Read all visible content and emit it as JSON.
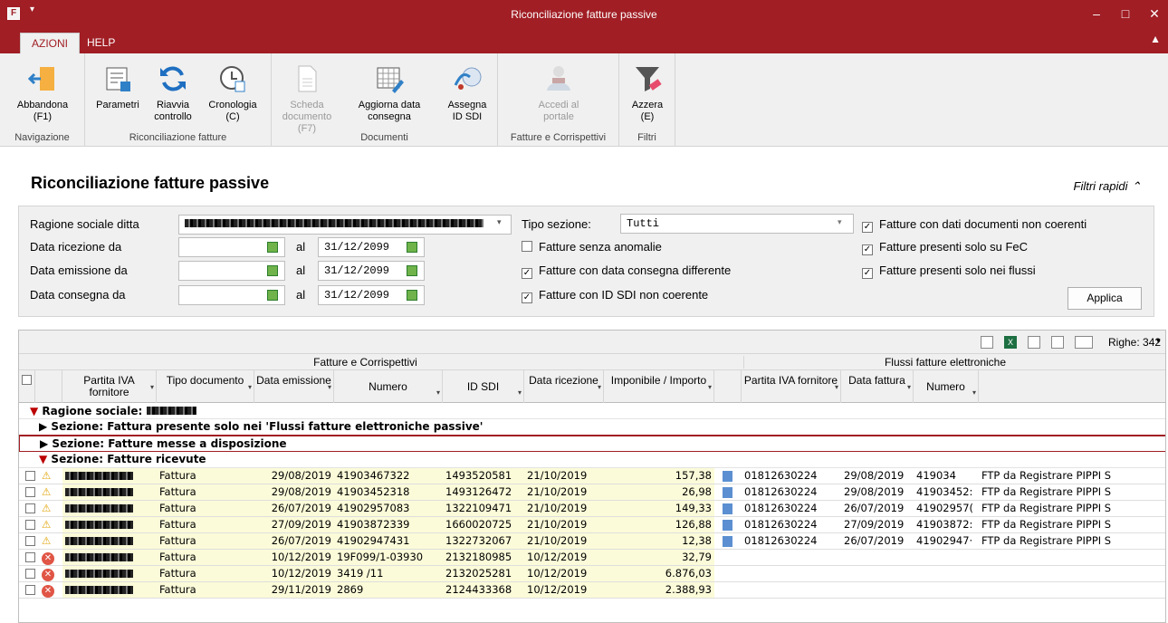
{
  "app": {
    "title": "Riconciliazione fatture passive",
    "icon": "app-logo-icon"
  },
  "tabs": [
    {
      "label": "AZIONI",
      "active": true
    },
    {
      "label": "HELP",
      "active": false
    }
  ],
  "ribbon": {
    "groups": [
      {
        "label": "Navigazione",
        "buttons": [
          {
            "label": "Abbandona",
            "sub": "(F1)",
            "icon": "exit-door-icon",
            "enabled": true
          }
        ]
      },
      {
        "label": "Riconciliazione fatture",
        "buttons": [
          {
            "label": "Parametri",
            "sub": "",
            "icon": "parameters-form-icon",
            "enabled": true
          },
          {
            "label": "Riavvia",
            "sub": "controllo",
            "icon": "refresh-icon",
            "enabled": true
          },
          {
            "label": "Cronologia",
            "sub": "(C)",
            "icon": "history-clock-icon",
            "enabled": true
          }
        ]
      },
      {
        "label": "Documenti",
        "buttons": [
          {
            "label": "Scheda",
            "sub": "documento (F7)",
            "icon": "document-sheet-icon",
            "enabled": false
          },
          {
            "label": "Aggiorna data",
            "sub": "consegna",
            "icon": "calendar-edit-icon",
            "enabled": true
          },
          {
            "label": "Assegna",
            "sub": "ID SDI",
            "icon": "assign-id-icon",
            "enabled": true
          }
        ]
      },
      {
        "label": "Fatture e Corrispettivi",
        "buttons": [
          {
            "label": "Accedi al",
            "sub": "portale",
            "icon": "portal-access-icon",
            "enabled": false
          }
        ]
      },
      {
        "label": "Filtri",
        "buttons": [
          {
            "label": "Azzera",
            "sub": "(E)",
            "icon": "filter-clear-icon",
            "enabled": true
          }
        ]
      }
    ]
  },
  "page": {
    "heading": "Riconciliazione fatture passive",
    "quick_filters": "Filtri rapidi"
  },
  "filters": {
    "ragione_label": "Ragione sociale ditta",
    "ricezione_label": "Data ricezione da",
    "emissione_label": "Data emissione da",
    "consegna_label": "Data consegna da",
    "al": "al",
    "ricezione_to": "31/12/2099",
    "emissione_to": "31/12/2099",
    "consegna_to": "31/12/2099",
    "tipo_label": "Tipo sezione:",
    "tipo_value": "Tutti",
    "checks": [
      {
        "label": "Fatture senza anomalie",
        "checked": false
      },
      {
        "label": "Fatture con data consegna differente",
        "checked": true
      },
      {
        "label": "Fatture con ID SDI non coerente",
        "checked": true
      },
      {
        "label": "Fatture con dati documenti non coerenti",
        "checked": true
      },
      {
        "label": "Fatture presenti solo su FeC",
        "checked": true
      },
      {
        "label": "Fatture presenti solo nei flussi",
        "checked": true
      }
    ],
    "apply_label": "Applica"
  },
  "grid": {
    "righe": "Righe: 342",
    "band1": "Fatture e Corrispettivi",
    "band2": "Flussi fatture elettroniche",
    "columns": [
      "Partita IVA fornitore",
      "Tipo documento",
      "Data emissione",
      "Numero",
      "ID SDI",
      "Data ricezione",
      "Imponibile / Importo",
      "Partita IVA fornitore",
      "Data fattura",
      "Numero"
    ],
    "group_ragione": "Ragione sociale:",
    "sections": [
      "Sezione:  Fattura presente solo nei 'Flussi fatture elettroniche passive'",
      "Sezione:  Fatture messe a disposizione",
      "Sezione:  Fatture ricevute"
    ],
    "rows": [
      {
        "status": "warning",
        "tipo": "Fattura",
        "data_em": "29/08/2019",
        "numero": "41903467322",
        "idsdi": "1493520581",
        "data_ric": "21/10/2019",
        "importo": "157,38",
        "piva2": "01812630224",
        "data_f": "29/08/2019",
        "numero2": "419034",
        "descr": "FTP da Registrare PIPPI S"
      },
      {
        "status": "warning",
        "tipo": "Fattura",
        "data_em": "29/08/2019",
        "numero": "41903452318",
        "idsdi": "1493126472",
        "data_ric": "21/10/2019",
        "importo": "26,98",
        "piva2": "01812630224",
        "data_f": "29/08/2019",
        "numero2": "41903452:",
        "descr": "FTP da Registrare PIPPI S"
      },
      {
        "status": "warning",
        "tipo": "Fattura",
        "data_em": "26/07/2019",
        "numero": "41902957083",
        "idsdi": "1322109471",
        "data_ric": "21/10/2019",
        "importo": "149,33",
        "piva2": "01812630224",
        "data_f": "26/07/2019",
        "numero2": "41902957(",
        "descr": "FTP da Registrare PIPPI S"
      },
      {
        "status": "warning",
        "tipo": "Fattura",
        "data_em": "27/09/2019",
        "numero": "41903872339",
        "idsdi": "1660020725",
        "data_ric": "21/10/2019",
        "importo": "126,88",
        "piva2": "01812630224",
        "data_f": "27/09/2019",
        "numero2": "41903872:",
        "descr": "FTP da Registrare PIPPI S"
      },
      {
        "status": "warning",
        "tipo": "Fattura",
        "data_em": "26/07/2019",
        "numero": "41902947431",
        "idsdi": "1322732067",
        "data_ric": "21/10/2019",
        "importo": "12,38",
        "piva2": "01812630224",
        "data_f": "26/07/2019",
        "numero2": "41902947·",
        "descr": "FTP da Registrare PIPPI S"
      },
      {
        "status": "error",
        "tipo": "Fattura",
        "data_em": "10/12/2019",
        "numero": "19F099/1-03930",
        "idsdi": "2132180985",
        "data_ric": "10/12/2019",
        "importo": "32,79",
        "piva2": "",
        "data_f": "",
        "numero2": "",
        "descr": ""
      },
      {
        "status": "error",
        "tipo": "Fattura",
        "data_em": "10/12/2019",
        "numero": "3419 /11",
        "idsdi": "2132025281",
        "data_ric": "10/12/2019",
        "importo": "6.876,03",
        "piva2": "",
        "data_f": "",
        "numero2": "",
        "descr": ""
      },
      {
        "status": "error",
        "tipo": "Fattura",
        "data_em": "29/11/2019",
        "numero": "2869",
        "idsdi": "2124433368",
        "data_ric": "10/12/2019",
        "importo": "2.388,93",
        "piva2": "",
        "data_f": "",
        "numero2": "",
        "descr": ""
      }
    ]
  }
}
